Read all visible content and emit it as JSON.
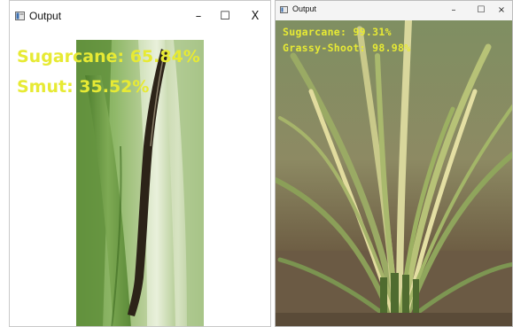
{
  "windows": [
    {
      "title": "Output",
      "controls": {
        "minimize": "–",
        "maximize": "☐",
        "close": "X"
      },
      "image": "sugarcane leaf with smut lesion",
      "predictions": [
        "Sugarcane: 65.84%",
        "Smut: 35.52%"
      ]
    },
    {
      "title": "Output",
      "controls": {
        "minimize": "–",
        "maximize": "☐",
        "close": "×"
      },
      "image": "sugarcane clump with grassy shoot",
      "predictions": [
        "Sugarcane: 99.31%",
        "Grassy-Shoot: 98.98%"
      ]
    }
  ],
  "colors": {
    "prediction_text": "#e7ea34",
    "leaf_green": "#5e8f3c",
    "lesion_dark": "#2c2318",
    "soil": "#6b5a44"
  }
}
